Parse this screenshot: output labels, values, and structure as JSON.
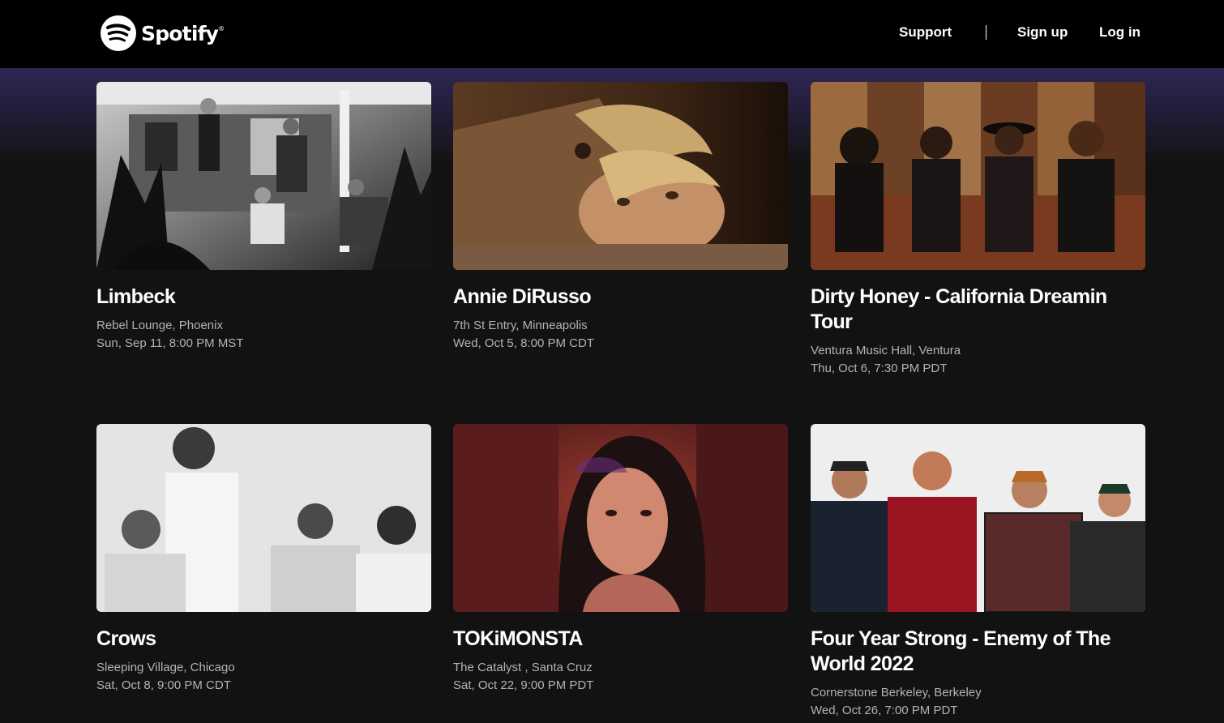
{
  "header": {
    "brand": "Spotify",
    "nav": {
      "support": "Support",
      "signup": "Sign up",
      "login": "Log in"
    }
  },
  "events": [
    {
      "title": "Limbeck",
      "venue": "Rebel Lounge, Phoenix",
      "date": "Sun, Sep 11, 8:00 PM MST"
    },
    {
      "title": "Annie DiRusso",
      "venue": "7th St Entry, Minneapolis",
      "date": "Wed, Oct 5, 8:00 PM CDT"
    },
    {
      "title": "Dirty Honey - California Dreamin Tour",
      "venue": "Ventura Music Hall, Ventura",
      "date": "Thu, Oct 6, 7:30 PM PDT"
    },
    {
      "title": "Crows",
      "venue": "Sleeping Village, Chicago",
      "date": "Sat, Oct 8, 9:00 PM CDT"
    },
    {
      "title": "TOKiMONSTA",
      "venue": "The Catalyst , Santa Cruz",
      "date": "Sat, Oct 22, 9:00 PM PDT"
    },
    {
      "title": "Four Year Strong - Enemy of The World 2022",
      "venue": "Cornerstone Berkeley, Berkeley",
      "date": "Wed, Oct 26, 7:00 PM PDT"
    }
  ]
}
